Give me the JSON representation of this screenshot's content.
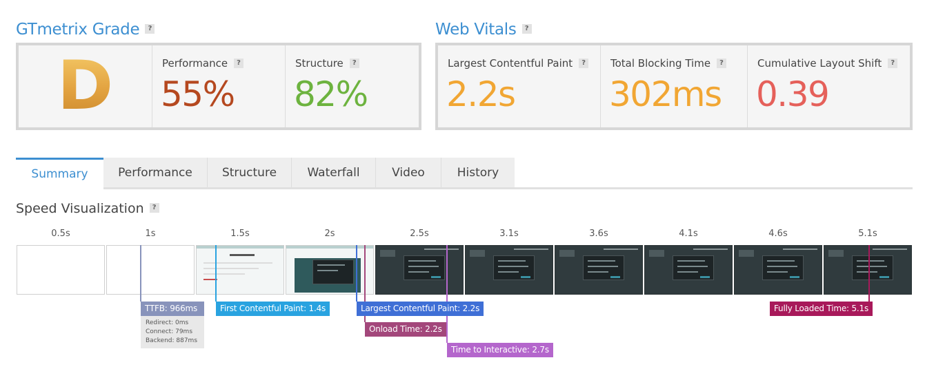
{
  "grade_section": {
    "title": "GTmetrix Grade",
    "help": "?"
  },
  "grade": {
    "letter": "D",
    "performance": {
      "label": "Performance",
      "value": "55%",
      "color": "#b5481f"
    },
    "structure": {
      "label": "Structure",
      "value": "82%",
      "color": "#6db33f"
    }
  },
  "vitals_section": {
    "title": "Web Vitals",
    "help": "?"
  },
  "vitals": [
    {
      "label": "Largest Contentful Paint",
      "value": "2.2s",
      "color": "#f1a633"
    },
    {
      "label": "Total Blocking Time",
      "value": "302ms",
      "color": "#f1a633"
    },
    {
      "label": "Cumulative Layout Shift",
      "value": "0.39",
      "color": "#e5605a"
    }
  ],
  "tabs": [
    "Summary",
    "Performance",
    "Structure",
    "Waterfall",
    "Video",
    "History"
  ],
  "active_tab": "Summary",
  "speed_viz": {
    "title": "Speed Visualization",
    "help": "?"
  },
  "timeline_ticks": [
    "0.5s",
    "1s",
    "1.5s",
    "2s",
    "2.5s",
    "3.1s",
    "3.6s",
    "4.1s",
    "4.6s",
    "5.1s"
  ],
  "frame_states": [
    "blank",
    "blank",
    "partial",
    "partial-dark",
    "dark",
    "dark",
    "dark",
    "dark",
    "dark",
    "dark"
  ],
  "markers": {
    "ttfb": {
      "label": "TTFB: 966ms",
      "color": "#8893bb"
    },
    "fcp": {
      "label": "First Contentful Paint: 1.4s",
      "color": "#29a3e0"
    },
    "lcp": {
      "label": "Largest Contentful Paint: 2.2s",
      "color": "#3f6fd6"
    },
    "onload": {
      "label": "Onload Time: 2.2s",
      "color": "#a3477b"
    },
    "tti": {
      "label": "Time to Interactive: 2.7s",
      "color": "#b466cc"
    },
    "fully_loaded": {
      "label": "Fully Loaded Time: 5.1s",
      "color": "#a8195a"
    }
  },
  "ttfb_details": {
    "redirect": "Redirect: 0ms",
    "connect": "Connect: 79ms",
    "backend": "Backend: 887ms"
  }
}
